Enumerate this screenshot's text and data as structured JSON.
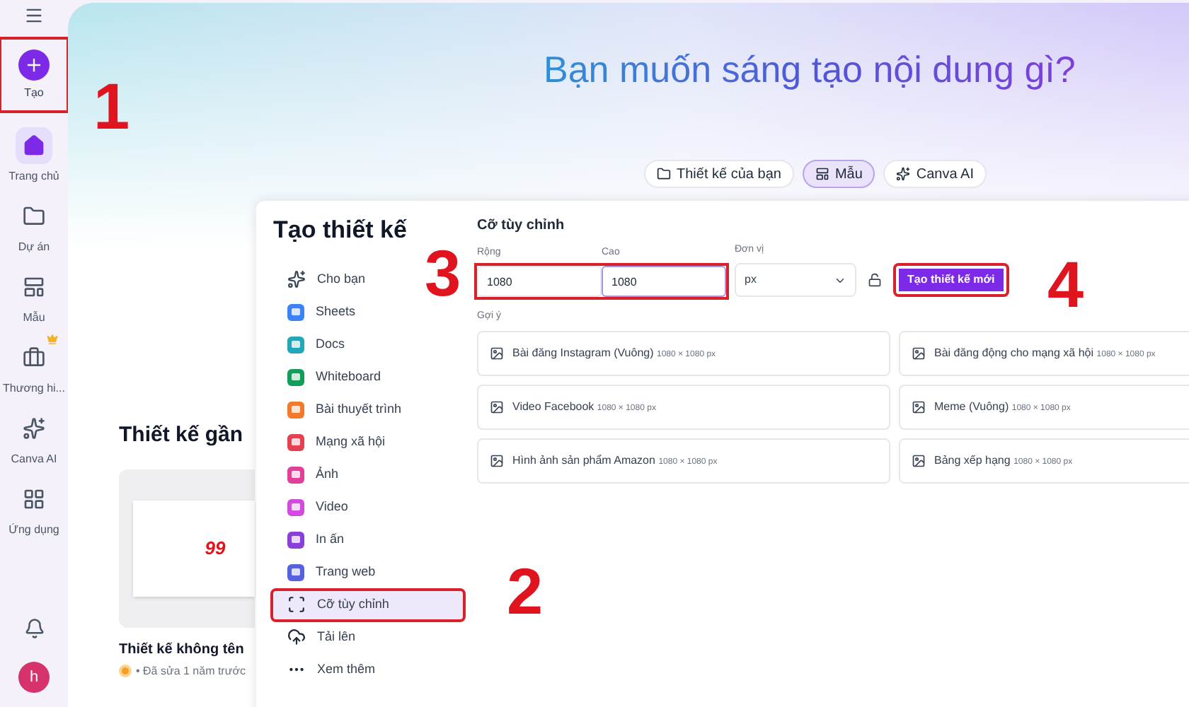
{
  "sidebar": {
    "create": {
      "label": "Tạo",
      "highlighted": true
    },
    "items": [
      {
        "label": "Trang chủ",
        "kind": "home",
        "selected": true,
        "badge": false
      },
      {
        "label": "Dự án",
        "kind": "projects",
        "selected": false,
        "badge": false
      },
      {
        "label": "Mẫu",
        "kind": "templates",
        "selected": false,
        "badge": false
      },
      {
        "label": "Thương hi...",
        "kind": "brand",
        "selected": false,
        "badge": true
      },
      {
        "label": "Canva AI",
        "kind": "ai",
        "selected": false,
        "badge": false
      },
      {
        "label": "Ứng dụng",
        "kind": "apps",
        "selected": false,
        "badge": false
      }
    ],
    "avatar": "h"
  },
  "hero": {
    "title": "Bạn muốn sáng tạo nội dung gì?",
    "tabs": [
      {
        "label": "Thiết kế của bạn",
        "kind": "folder",
        "selected": false
      },
      {
        "label": "Mẫu",
        "kind": "templates",
        "selected": true
      },
      {
        "label": "Canva AI",
        "kind": "ai",
        "selected": false
      }
    ]
  },
  "recent": {
    "title": "Thiết kế gần",
    "designs": [
      {
        "thumbnail_text": "99",
        "name": "Thiết kế không tên",
        "meta": "• Đã sửa 1 năm trước"
      }
    ]
  },
  "create_panel": {
    "title": "Tạo thiết kế",
    "menu": [
      {
        "label": "Cho bạn",
        "kind": "sparkle",
        "selected": false,
        "highlighted": false
      },
      {
        "label": "Sheets",
        "kind": "colored",
        "color": "#3b82f6",
        "selected": false,
        "highlighted": false
      },
      {
        "label": "Docs",
        "kind": "colored",
        "color": "#22a7b8",
        "selected": false,
        "highlighted": false
      },
      {
        "label": "Whiteboard",
        "kind": "colored",
        "color": "#139d5b",
        "selected": false,
        "highlighted": false
      },
      {
        "label": "Bài thuyết trình",
        "kind": "colored",
        "color": "#f27a2a",
        "selected": false,
        "highlighted": false
      },
      {
        "label": "Mạng xã hội",
        "kind": "colored",
        "color": "#e5404f",
        "selected": false,
        "highlighted": false
      },
      {
        "label": "Ảnh",
        "kind": "colored",
        "color": "#e03f9a",
        "selected": false,
        "highlighted": false
      },
      {
        "label": "Video",
        "kind": "colored",
        "color": "#d24ade",
        "selected": false,
        "highlighted": false
      },
      {
        "label": "In ấn",
        "kind": "colored",
        "color": "#8a3fd8",
        "selected": false,
        "highlighted": false
      },
      {
        "label": "Trang web",
        "kind": "colored",
        "color": "#5661e0",
        "selected": false,
        "highlighted": false
      },
      {
        "label": "Cỡ tùy chỉnh",
        "kind": "custom",
        "selected": true,
        "highlighted": true
      },
      {
        "label": "Tải lên",
        "kind": "upload",
        "selected": false,
        "highlighted": false
      },
      {
        "label": "Xem thêm",
        "kind": "more",
        "selected": false,
        "highlighted": false
      }
    ],
    "custom_size": {
      "title": "Cỡ tùy chỉnh",
      "width": {
        "label": "Rộng",
        "value": "1080"
      },
      "height": {
        "label": "Cao",
        "value": "1080"
      },
      "fields_highlighted": true,
      "unit": {
        "label": "Đơn vị",
        "value": "px"
      },
      "create_button": {
        "label": "Tạo thiết kế mới",
        "highlighted": true
      },
      "suggestions_label": "Gợi ý",
      "suggestions": [
        {
          "name": "Bài đăng Instagram (Vuông)",
          "size": "1080 × 1080 px"
        },
        {
          "name": "Bài đăng động cho mạng xã hội",
          "size": "1080 × 1080 px"
        },
        {
          "name": "Video Facebook",
          "size": "1080 × 1080 px"
        },
        {
          "name": "Meme (Vuông)",
          "size": "1080 × 1080 px"
        },
        {
          "name": "Hình ảnh sản phẩm Amazon",
          "size": "1080 × 1080 px"
        },
        {
          "name": "Bảng xếp hạng",
          "size": "1080 × 1080 px"
        }
      ]
    }
  },
  "annotations": [
    {
      "label": "1"
    },
    {
      "label": "2"
    },
    {
      "label": "3"
    },
    {
      "label": "4"
    }
  ]
}
